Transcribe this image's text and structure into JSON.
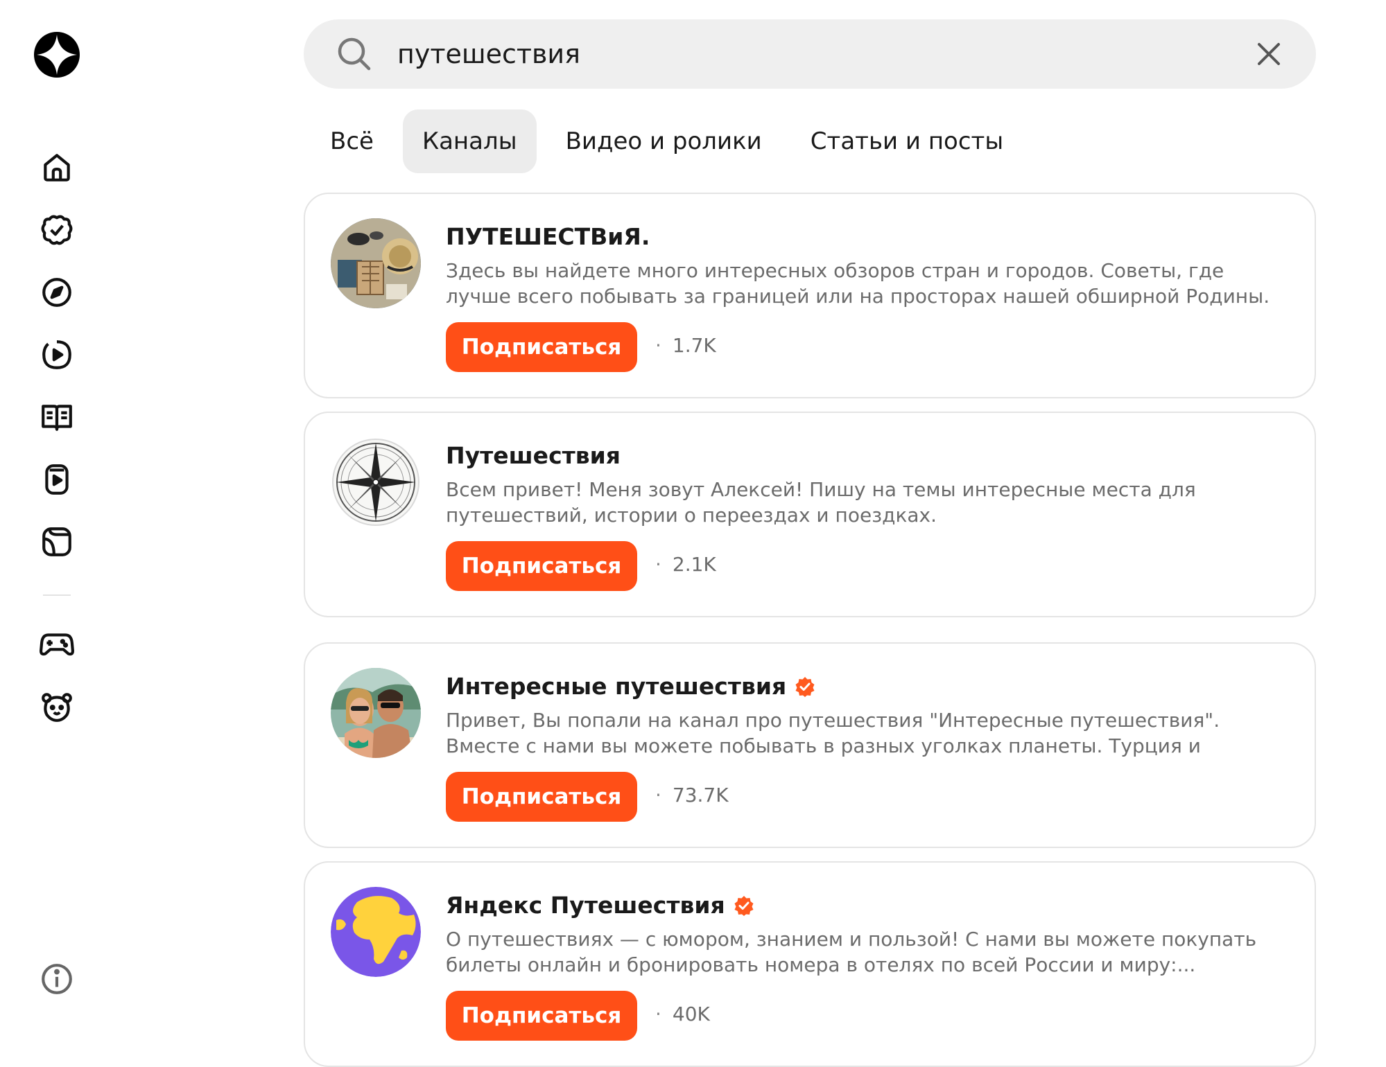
{
  "search": {
    "query": "путешествия"
  },
  "tabs": [
    {
      "label": "Всё",
      "active": false
    },
    {
      "label": "Каналы",
      "active": true
    },
    {
      "label": "Видео и ролики",
      "active": false
    },
    {
      "label": "Статьи и посты",
      "active": false
    }
  ],
  "sidebar": {
    "icons": [
      "home-icon",
      "subscriptions-icon",
      "compass-icon",
      "video-icon",
      "articles-icon",
      "shorts-icon",
      "library-icon",
      "gamepad-icon",
      "kids-bear-icon",
      "info-icon"
    ]
  },
  "accent_color": "#ff4f17",
  "channels": [
    {
      "title": "ПУТЕШЕСТВиЯ.",
      "verified": false,
      "description": "Здесь вы найдете много интересных обзоров стран и городов. Советы, где лучше всего побывать за границей или на просторах нашей обширной Родины. Присоединяйтесь, и...",
      "button": "Подписаться",
      "subscribers": "1.7K",
      "avatar": "travel-items-avatar"
    },
    {
      "title": "Путешествия",
      "verified": false,
      "description": "Всем привет! Меня зовут Алексей! Пишу на темы интересные места для путешествий, истории о переездах и поездках.",
      "button": "Подписаться",
      "subscribers": "2.1K",
      "avatar": "compass-rose-avatar"
    },
    {
      "title": "Интересные путешествия",
      "verified": true,
      "description": "Привет, Вы попали на канал про путешествия \"Интересные путешествия\". Вместе с нами вы можете побывать в разных уголках планеты. Турция и знаменитое турецкое все...",
      "button": "Подписаться",
      "subscribers": "73.7K",
      "avatar": "couple-photo-avatar"
    },
    {
      "title": "Яндекс Путешествия",
      "verified": true,
      "description": "О путешествиях — с юмором, знанием и пользой! С нами вы можете покупать билеты онлайн и бронировать номера в отелях по всей России и миру:...",
      "button": "Подписаться",
      "subscribers": "40K",
      "avatar": "globe-avatar"
    }
  ]
}
